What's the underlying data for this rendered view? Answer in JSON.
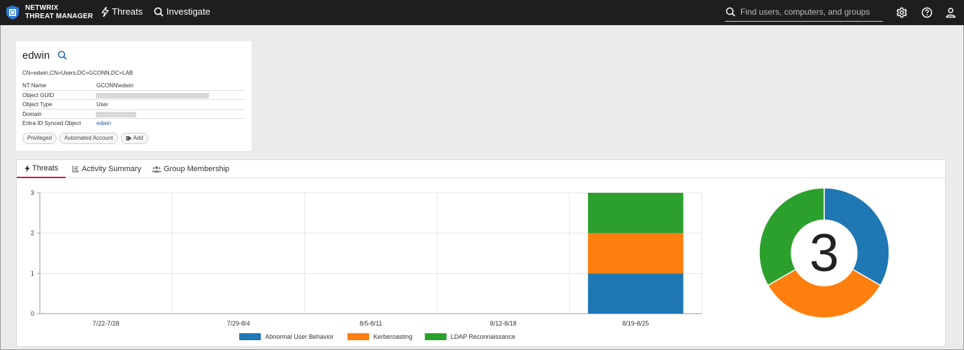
{
  "app": {
    "brand_line1": "NETWRIX",
    "brand_line2": "THREAT MANAGER",
    "nav": [
      {
        "label": "Threats",
        "icon": "bolt-icon"
      },
      {
        "label": "Investigate",
        "icon": "search-icon"
      }
    ],
    "search": {
      "placeholder": "Find users, computers, and groups",
      "value": ""
    },
    "icons": [
      "gear-icon",
      "help-icon",
      "user-icon"
    ],
    "bar_color": "#1e1e1e"
  },
  "entity": {
    "name": "edwin",
    "dn": "CN=edwin,CN=Users,DC=GCONN,DC=LAB",
    "properties": [
      {
        "key": "NT Name",
        "value": "GCONN\\edwin"
      },
      {
        "key": "Object GUID",
        "value": ""
      },
      {
        "key": "Object Type",
        "value": "User"
      },
      {
        "key": "Domain",
        "value": ""
      },
      {
        "key": "Entra ID Synced Object",
        "value": "edwin"
      }
    ],
    "tags": [
      "Privileged",
      "Automated Account"
    ],
    "add_tag_label": "Add"
  },
  "tabs": [
    {
      "label": "Threats",
      "icon": "bolt-icon",
      "active": true
    },
    {
      "label": "Activity Summary",
      "icon": "list-icon",
      "active": false
    },
    {
      "label": "Group Membership",
      "icon": "group-icon",
      "active": false
    }
  ],
  "chart_data": [
    {
      "type": "bar",
      "stacked": true,
      "categories": [
        "7/22-7/28",
        "7/29-8/4",
        "8/5-8/11",
        "8/12-8/18",
        "8/19-8/25"
      ],
      "series": [
        {
          "name": "Abnormal User Behavior",
          "color": "#1f77b4",
          "values": [
            0,
            0,
            0,
            0,
            1
          ]
        },
        {
          "name": "Kerberoasting",
          "color": "#ff7f0e",
          "values": [
            0,
            0,
            0,
            0,
            1
          ]
        },
        {
          "name": "LDAP Reconnaissance",
          "color": "#2ca02c",
          "values": [
            0,
            0,
            0,
            0,
            1
          ]
        }
      ],
      "ylim": [
        0,
        3
      ],
      "yticks": [
        "0",
        "1",
        "2",
        "3"
      ],
      "grid": true,
      "legend": "bottom"
    },
    {
      "type": "pie",
      "donut": true,
      "center_label": "3",
      "slices": [
        {
          "name": "Abnormal User Behavior",
          "value": 1,
          "color": "#1f77b4"
        },
        {
          "name": "Kerberoasting",
          "value": 1,
          "color": "#ff7f0e"
        },
        {
          "name": "LDAP Reconnaissance",
          "value": 1,
          "color": "#2ca02c"
        }
      ]
    }
  ]
}
